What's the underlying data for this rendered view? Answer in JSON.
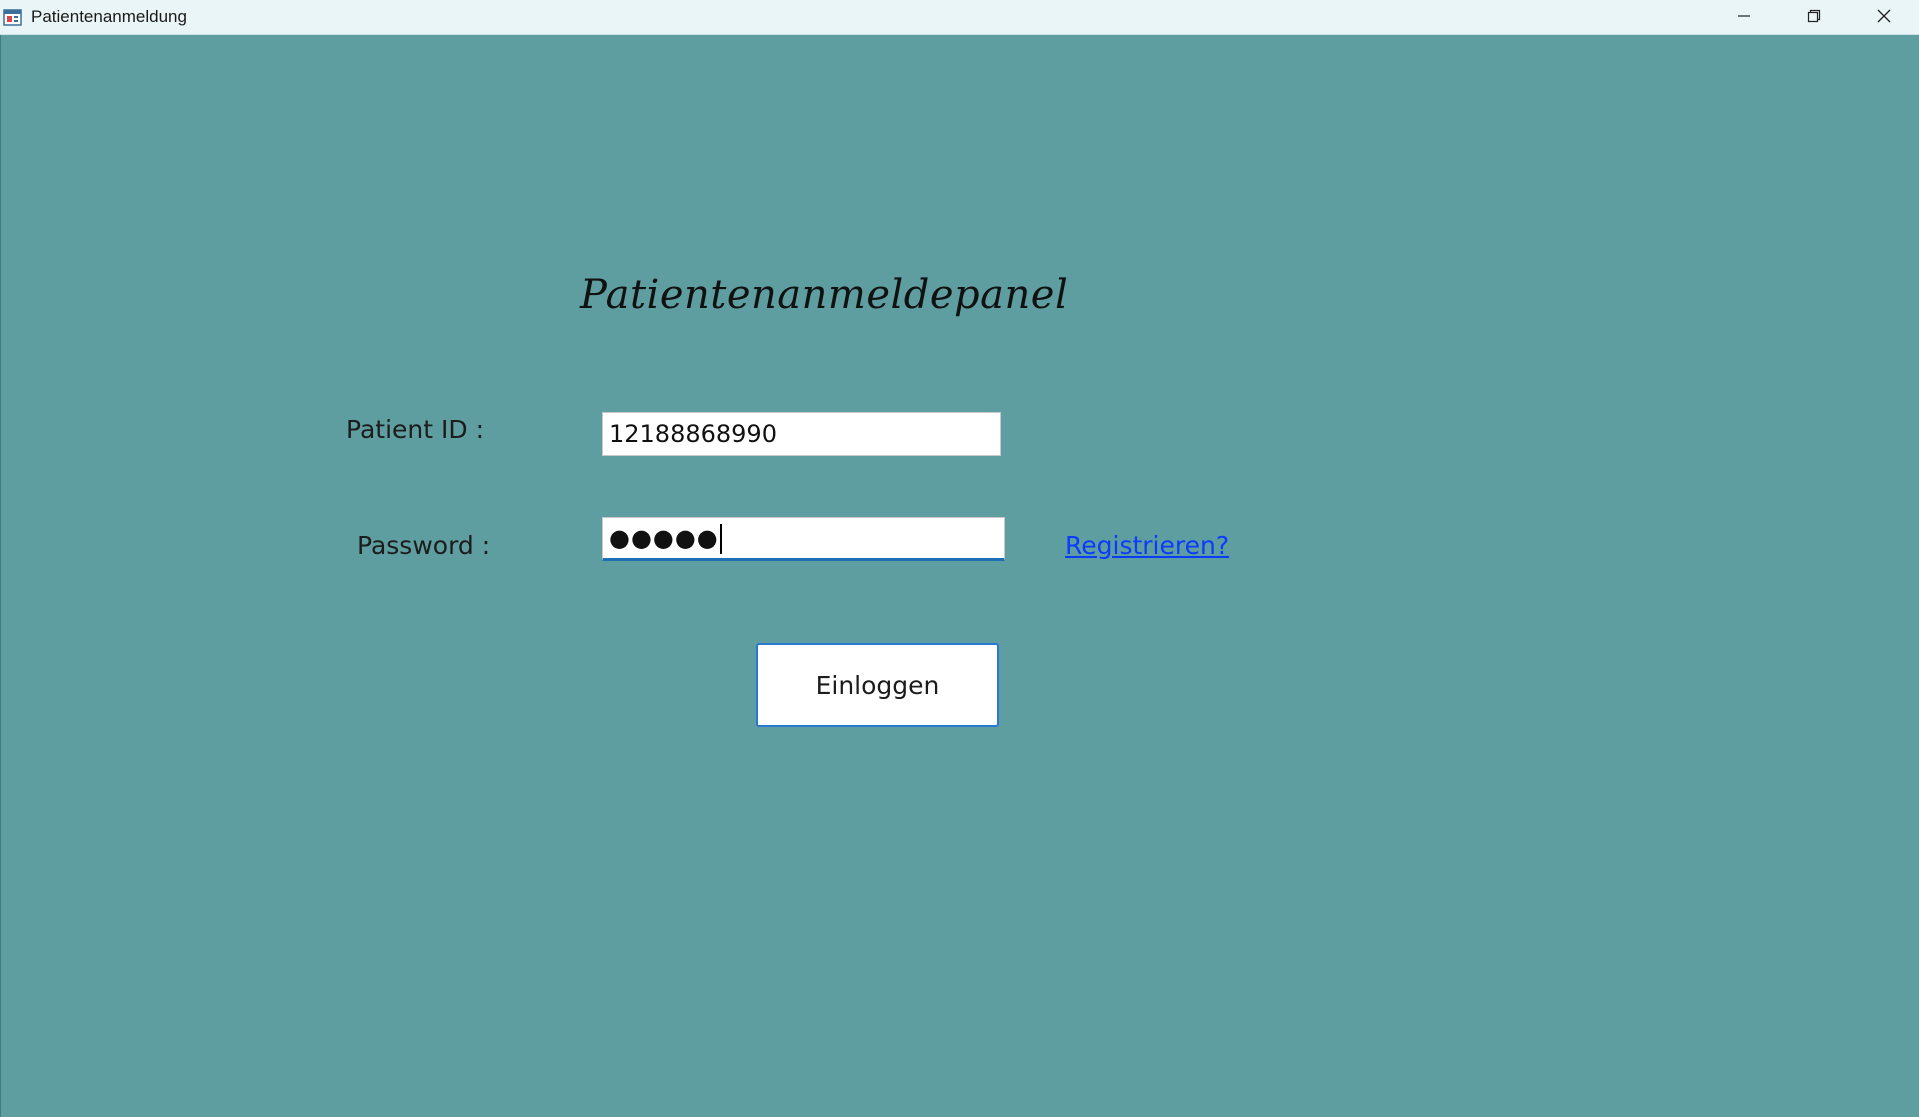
{
  "window": {
    "title": "Patientenanmeldung",
    "icon": "app-window-icon",
    "controls": [
      "minimize-icon",
      "restore-icon",
      "close-icon"
    ]
  },
  "panel": {
    "title": "Patientenanmeldepanel"
  },
  "form": {
    "patient_id_label": "Patient ID :",
    "patient_id_value": "12188868990",
    "password_label": "Password :",
    "password_masked": "●●●●●",
    "register_link": "Registrieren?",
    "login_button": "Einloggen"
  },
  "colors": {
    "background": "#5f9ea0",
    "titlebar": "#e9f5f6",
    "link": "#0a3bff",
    "focus_border": "#1f6fb5",
    "button_border": "#2b78d0"
  }
}
